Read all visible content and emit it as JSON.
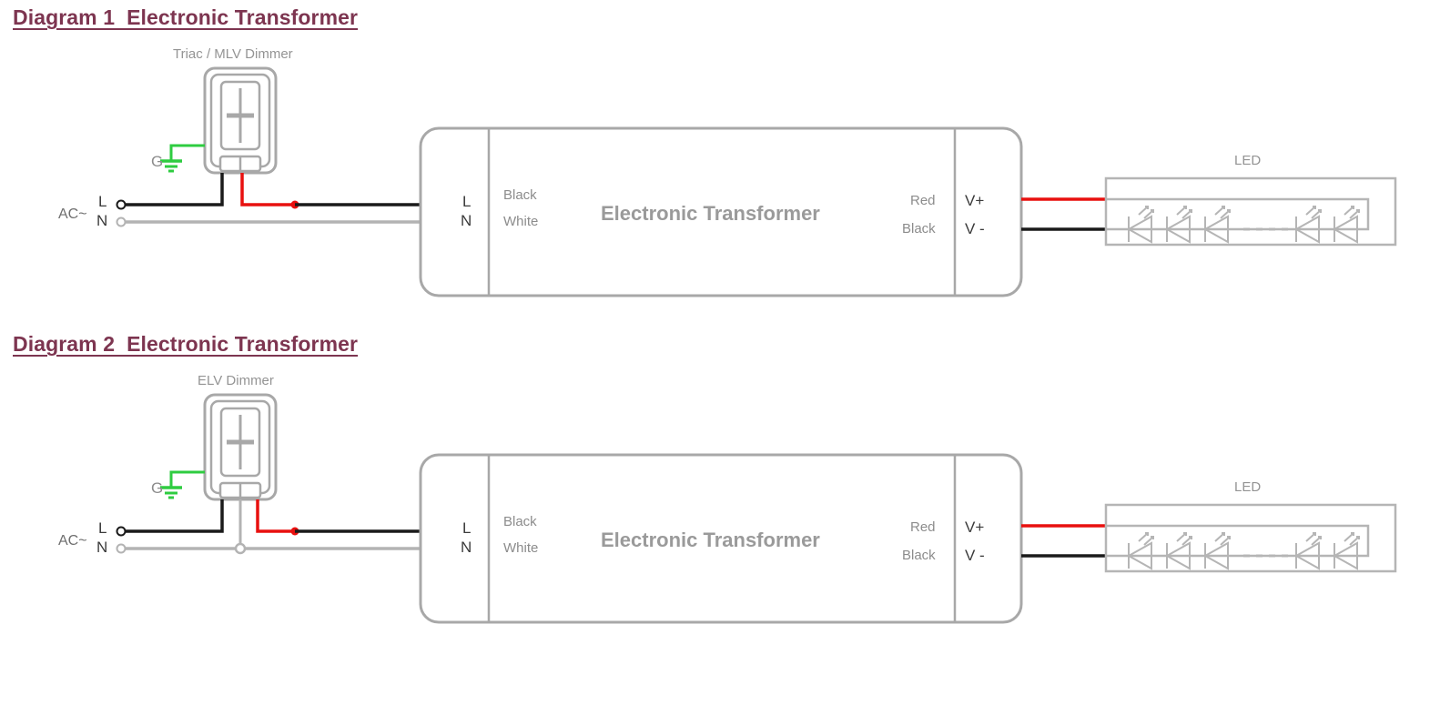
{
  "page": {
    "background": "#ffffff",
    "title_color": "#7d3550",
    "wire_colors": {
      "line_black": "#1a1a1a",
      "neutral_gray": "#b3b3b3",
      "load_red": "#e8100f",
      "ground_green": "#2ecc40",
      "outline_gray": "#a8a8a8",
      "text_gray": "#8c8c8c"
    }
  },
  "diagrams": [
    {
      "id": "diagram-1",
      "title": "Diagram 1  Electronic Transformer",
      "dimmer": {
        "caption": "Triac / MLV Dimmer",
        "ground_label": "G",
        "has_neutral_wire": false
      },
      "source": {
        "ac_label": "AC~",
        "line_label": "L",
        "neutral_label": "N"
      },
      "transformer": {
        "name": "Electronic Transformer",
        "input_terminals": [
          "L",
          "N"
        ],
        "input_wire_colors": [
          "Black",
          "White"
        ],
        "output_wire_colors": [
          "Red",
          "Black"
        ],
        "output_terminals": [
          "V+",
          "V -"
        ]
      },
      "load": {
        "caption": "LED",
        "led_count_left": 3,
        "led_count_right": 2,
        "ellipsis_dots": 4
      }
    },
    {
      "id": "diagram-2",
      "title": "Diagram 2  Electronic Transformer",
      "dimmer": {
        "caption": "ELV Dimmer",
        "ground_label": "G",
        "has_neutral_wire": true
      },
      "source": {
        "ac_label": "AC~",
        "line_label": "L",
        "neutral_label": "N"
      },
      "transformer": {
        "name": "Electronic Transformer",
        "input_terminals": [
          "L",
          "N"
        ],
        "input_wire_colors": [
          "Black",
          "White"
        ],
        "output_wire_colors": [
          "Red",
          "Black"
        ],
        "output_terminals": [
          "V+",
          "V -"
        ]
      },
      "load": {
        "caption": "LED",
        "led_count_left": 3,
        "led_count_right": 2,
        "ellipsis_dots": 4
      }
    }
  ]
}
